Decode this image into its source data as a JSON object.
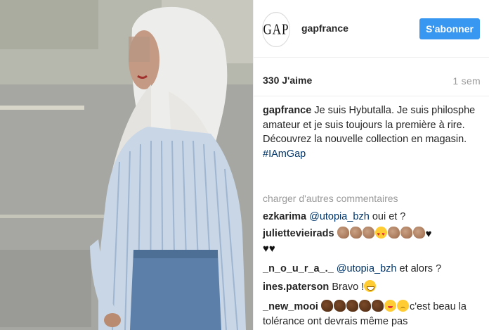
{
  "post": {
    "username": "gapfrance",
    "logo_text": "GAP",
    "follow_label": "S'abonner",
    "likes": "330 J'aime",
    "time": "1 sem"
  },
  "caption": {
    "username": "gapfrance",
    "text_1": "Je suis Hybutalla. Je suis philosphe amateur et je suis toujours la première à rire.",
    "text_2": "Découvrez la nouvelle collection en magasin.",
    "hashtag": "#IAmGap"
  },
  "load_more": "charger d'autres commentaires",
  "comments": [
    {
      "username": "ezkarima",
      "mention": "@utopia_bzh",
      "text": "oui et ?"
    },
    {
      "username": "juliettevieirads",
      "emojis": [
        "clap-icon",
        "clap-icon",
        "clap-icon",
        "heart-eyes-icon",
        "clap-icon",
        "clap-icon",
        "clap-icon",
        "black-heart-icon",
        "black-heart-icon",
        "black-heart-icon"
      ]
    },
    {
      "username": "_n_o_u_r_a_._",
      "mention": "@utopia_bzh",
      "text": "et alors ?"
    },
    {
      "username": "ines.paterson",
      "text": "Bravo !",
      "emojis": [
        "grinning-face-icon"
      ]
    },
    {
      "username": "_new_mooi",
      "text": "c'est beau la tolérance ont devrais même pas",
      "emojis": [
        "dark-clap-icon",
        "dark-clap-icon",
        "dark-clap-icon",
        "dark-clap-icon",
        "dark-clap-icon",
        "winking-kiss-icon",
        "sad-face-icon"
      ]
    }
  ],
  "colors": {
    "follow_button": "#3897f0",
    "link": "#003569",
    "muted": "#999999"
  }
}
